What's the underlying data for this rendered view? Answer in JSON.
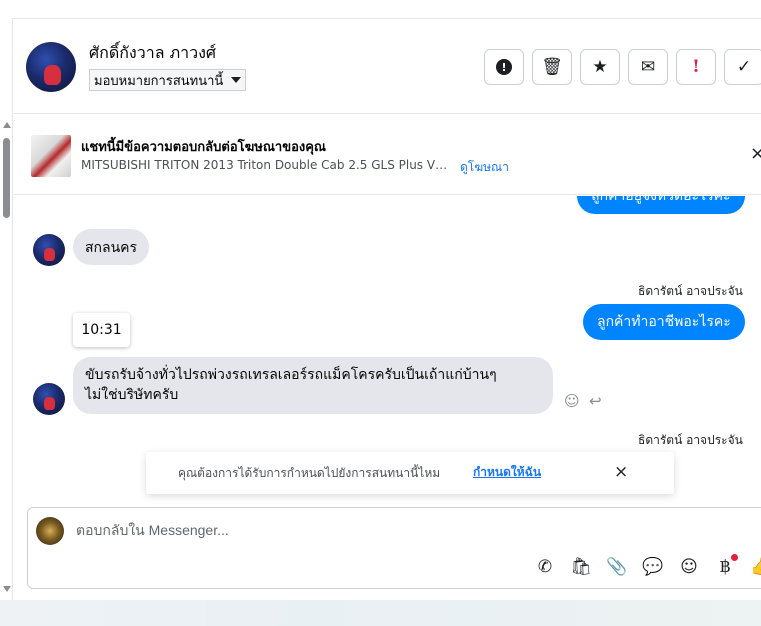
{
  "header": {
    "contact_name": "ศักดิ์กังวาล ภาวงศ์",
    "assign_label": "มอบหมายการสนทนานี้"
  },
  "actions": {
    "report_icon": "!",
    "delete_icon": "🗑",
    "star_icon": "★",
    "mail_icon": "✉",
    "spam_icon": "!",
    "done_icon": "✓"
  },
  "ad_reference": {
    "title": "แชทนี้มีข้อความตอบกลับต่อโฆษณาของคุณ",
    "subtitle": "MITSUBISHI TRITON 2013 Triton Double Cab 2.5 GLS Plus VG T...",
    "view_ad_label": "ดูโฆษณา",
    "close_icon": "×"
  },
  "messages": {
    "outgoing_partial": "ลูกค้าอยู่จังหวัดอะไรคะ",
    "incoming_1": "สกลนคร",
    "sender_1": "ธิดารัตน์ อาจประจัน",
    "outgoing_2": "ลูกค้าทำอาชีพอะไรคะ",
    "timestamp": "10:31",
    "incoming_2_line1": "ขับรถรับจ้างทั่วไปรถพ่วงรถเทรลเลอร์รถแม็คโครครับเป็นเถ้าแก่บ้านๆ",
    "incoming_2_line2": "ไม่ใช่บริษัทครับ",
    "sender_2": "ธิดารัตน์ อาจประจัน",
    "react_icon": "☺",
    "reply_icon": "↩"
  },
  "reminder": {
    "text": "คุณต้องการได้รับการกำหนดไปยังการสนทนานี้ไหม",
    "link": "กำหนดให้ฉัน",
    "close_icon": "×"
  },
  "composer": {
    "placeholder": "ตอบกลับใน Messenger...",
    "tools": {
      "call": "✆",
      "shop": "🛍",
      "attach": "📎",
      "chat": "💬",
      "emoji": "☺",
      "baht": "฿",
      "like": "👍"
    }
  },
  "colors": {
    "accent": "#0084ff",
    "link": "#1877f2",
    "incoming_bubble": "#e4e6eb",
    "alert_red": "#e41e3f"
  }
}
